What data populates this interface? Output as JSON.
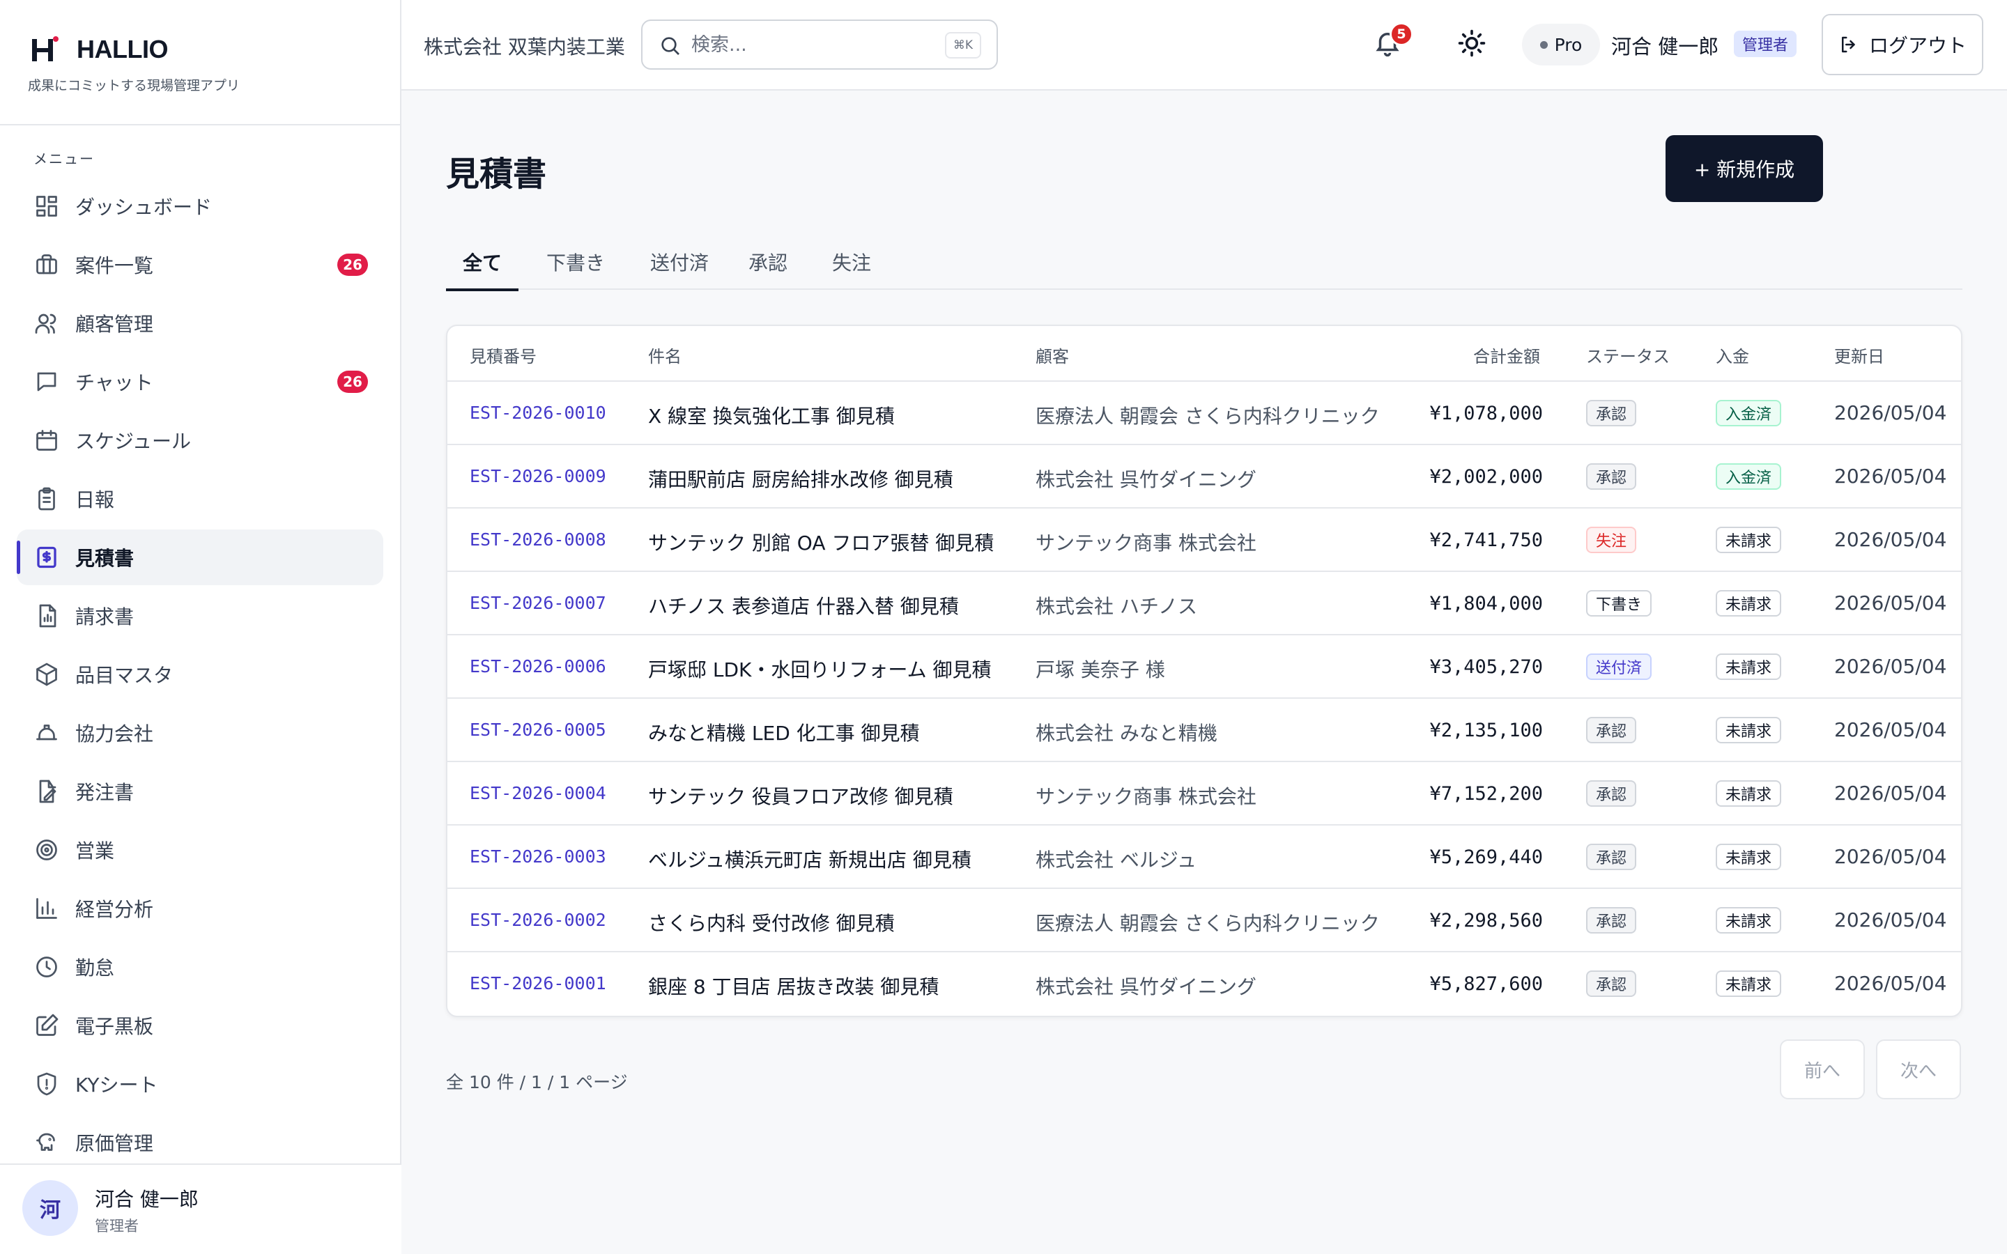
{
  "brand": {
    "name": "HALLIO",
    "tagline": "成果にコミットする現場管理アプリ"
  },
  "sidebar": {
    "menu_heading": "メニュー",
    "items": [
      {
        "label": "ダッシュボード",
        "icon": "dashboard-icon",
        "badge": ""
      },
      {
        "label": "案件一覧",
        "icon": "briefcase-icon",
        "badge": "26"
      },
      {
        "label": "顧客管理",
        "icon": "users-icon",
        "badge": ""
      },
      {
        "label": "チャット",
        "icon": "chat-icon",
        "badge": "26"
      },
      {
        "label": "スケジュール",
        "icon": "calendar-icon",
        "badge": ""
      },
      {
        "label": "日報",
        "icon": "clipboard-icon",
        "badge": ""
      },
      {
        "label": "見積書",
        "icon": "estimate-icon",
        "badge": "",
        "active": true
      },
      {
        "label": "請求書",
        "icon": "invoice-icon",
        "badge": ""
      },
      {
        "label": "品目マスタ",
        "icon": "box-icon",
        "badge": ""
      },
      {
        "label": "協力会社",
        "icon": "hardhat-icon",
        "badge": ""
      },
      {
        "label": "発注書",
        "icon": "order-icon",
        "badge": ""
      },
      {
        "label": "営業",
        "icon": "target-icon",
        "badge": ""
      },
      {
        "label": "経営分析",
        "icon": "chart-icon",
        "badge": ""
      },
      {
        "label": "勤怠",
        "icon": "clock-icon",
        "badge": ""
      },
      {
        "label": "電子黒板",
        "icon": "edit-icon",
        "badge": ""
      },
      {
        "label": "KYシート",
        "icon": "shield-icon",
        "badge": ""
      },
      {
        "label": "原価管理",
        "icon": "piggy-bank-icon",
        "badge": ""
      }
    ],
    "footer": {
      "avatar": "河",
      "name": "河合 健一郎",
      "role": "管理者"
    }
  },
  "header": {
    "company": "株式会社 双葉内装工業",
    "search_placeholder": "検索...",
    "search_shortcut": "⌘K",
    "notification_count": "5",
    "plan": "Pro",
    "user_name": "河合 健一郎",
    "user_role": "管理者",
    "logout_label": "ログアウト"
  },
  "main": {
    "title": "見積書",
    "new_button": "+ 新規作成",
    "tabs": [
      "全て",
      "下書き",
      "送付済",
      "承認",
      "失注"
    ],
    "active_tab": 0,
    "columns": [
      "見積番号",
      "件名",
      "顧客",
      "合計金額",
      "ステータス",
      "入金",
      "更新日"
    ],
    "rows": [
      {
        "number": "EST-2026-0010",
        "title": "X 線室 換気強化工事 御見積",
        "client": "医療法人 朝霞会 さくら内科クリニック",
        "amount": "¥1,078,000",
        "status": "承認",
        "status_kind": "approved",
        "payment": "入金済",
        "payment_kind": "paid",
        "updated": "2026/05/04"
      },
      {
        "number": "EST-2026-0009",
        "title": "蒲田駅前店 厨房給排水改修 御見積",
        "client": "株式会社 呉竹ダイニング",
        "amount": "¥2,002,000",
        "status": "承認",
        "status_kind": "approved",
        "payment": "入金済",
        "payment_kind": "paid",
        "updated": "2026/05/04"
      },
      {
        "number": "EST-2026-0008",
        "title": "サンテック 別館 OA フロア張替 御見積",
        "client": "サンテック商事 株式会社",
        "amount": "¥2,741,750",
        "status": "失注",
        "status_kind": "lost",
        "payment": "未請求",
        "payment_kind": "unbilled",
        "updated": "2026/05/04"
      },
      {
        "number": "EST-2026-0007",
        "title": "ハチノス 表参道店 什器入替 御見積",
        "client": "株式会社 ハチノス",
        "amount": "¥1,804,000",
        "status": "下書き",
        "status_kind": "draft",
        "payment": "未請求",
        "payment_kind": "unbilled",
        "updated": "2026/05/04"
      },
      {
        "number": "EST-2026-0006",
        "title": "戸塚邸 LDK・水回りリフォーム 御見積",
        "client": "戸塚 美奈子 様",
        "amount": "¥3,405,270",
        "status": "送付済",
        "status_kind": "sent",
        "payment": "未請求",
        "payment_kind": "unbilled",
        "updated": "2026/05/04"
      },
      {
        "number": "EST-2026-0005",
        "title": "みなと精機 LED 化工事 御見積",
        "client": "株式会社 みなと精機",
        "amount": "¥2,135,100",
        "status": "承認",
        "status_kind": "approved",
        "payment": "未請求",
        "payment_kind": "unbilled",
        "updated": "2026/05/04"
      },
      {
        "number": "EST-2026-0004",
        "title": "サンテック 役員フロア改修 御見積",
        "client": "サンテック商事 株式会社",
        "amount": "¥7,152,200",
        "status": "承認",
        "status_kind": "approved",
        "payment": "未請求",
        "payment_kind": "unbilled",
        "updated": "2026/05/04"
      },
      {
        "number": "EST-2026-0003",
        "title": "ベルジュ横浜元町店 新規出店 御見積",
        "client": "株式会社 ベルジュ",
        "amount": "¥5,269,440",
        "status": "承認",
        "status_kind": "approved",
        "payment": "未請求",
        "payment_kind": "unbilled",
        "updated": "2026/05/04"
      },
      {
        "number": "EST-2026-0002",
        "title": "さくら内科 受付改修 御見積",
        "client": "医療法人 朝霞会 さくら内科クリニック",
        "amount": "¥2,298,560",
        "status": "承認",
        "status_kind": "approved",
        "payment": "未請求",
        "payment_kind": "unbilled",
        "updated": "2026/05/04"
      },
      {
        "number": "EST-2026-0001",
        "title": "銀座 8 丁目店 居抜き改装 御見積",
        "client": "株式会社 呉竹ダイニング",
        "amount": "¥5,827,600",
        "status": "承認",
        "status_kind": "approved",
        "payment": "未請求",
        "payment_kind": "unbilled",
        "updated": "2026/05/04"
      }
    ],
    "pagination": {
      "info": "全 10 件 / 1 / 1 ページ",
      "prev": "前へ",
      "next": "次へ"
    }
  },
  "colors": {
    "accent": "#4338ca",
    "primary_button": "#0f172a",
    "badge_red": "#e11d48"
  }
}
